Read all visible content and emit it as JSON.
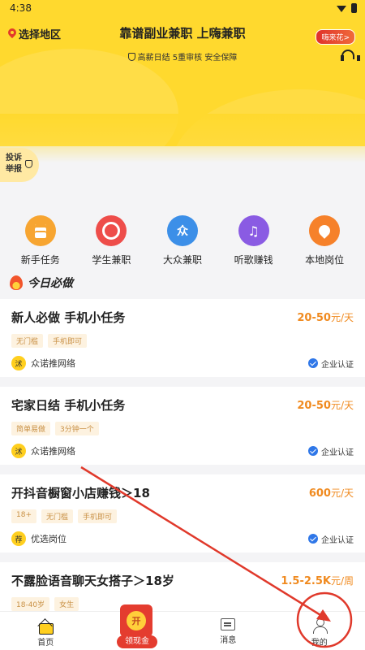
{
  "status_bar": {
    "time": "4:38"
  },
  "header": {
    "region_label": "选择地区",
    "title": "靠谱副业兼职 上嗨兼职",
    "subtitle": "高薪日结 5重审核 安全保障",
    "hot_badge": "嗨来花>"
  },
  "complaint": {
    "line1": "投诉",
    "line2": "举报"
  },
  "categories": [
    {
      "label": "新手任务",
      "icon": "task-doc-icon",
      "color": "#f7a531"
    },
    {
      "label": "学生兼职",
      "icon": "student-icon",
      "color": "#ee4d4a"
    },
    {
      "label": "大众兼职",
      "icon": "public-job-icon",
      "color": "#3c8fe8"
    },
    {
      "label": "听歌赚钱",
      "icon": "music-icon",
      "color": "#8a5be3"
    },
    {
      "label": "本地岗位",
      "icon": "location-icon",
      "color": "#f6812a"
    }
  ],
  "section_title": "今日必做",
  "jobs": [
    {
      "title": "新人必做 手机小任务",
      "salary": "20-50",
      "unit": "元/天",
      "tags": [
        "无门槛",
        "手机即可"
      ],
      "company": "众诺推网络",
      "avatar": "沭",
      "cert": "企业认证"
    },
    {
      "title": "宅家日结 手机小任务",
      "salary": "20-50",
      "unit": "元/天",
      "tags": [
        "简单易做",
        "3分钟一个"
      ],
      "company": "众诺推网络",
      "avatar": "沭",
      "cert": "企业认证"
    },
    {
      "title": "开抖音橱窗小店赚钱＞18",
      "salary": "600",
      "unit": "元/天",
      "tags": [
        "18+",
        "无门槛",
        "手机即可"
      ],
      "company": "优选岗位",
      "avatar": "荐",
      "cert": "企业认证"
    },
    {
      "title": "不露脸语音聊天女搭子＞18岁",
      "salary": "1.5-2.5K",
      "unit": "元/周",
      "tags": [
        "18-40岁",
        "女生"
      ],
      "company": "",
      "avatar": "",
      "cert": ""
    }
  ],
  "tabbar": {
    "home": "首页",
    "cash": "领现金",
    "cash_coin": "开",
    "messages": "消息",
    "me": "我的"
  },
  "colors": {
    "brand_yellow": "#ffd92e",
    "salary_orange": "#f08a1f",
    "annotation_red": "#e0392b"
  }
}
